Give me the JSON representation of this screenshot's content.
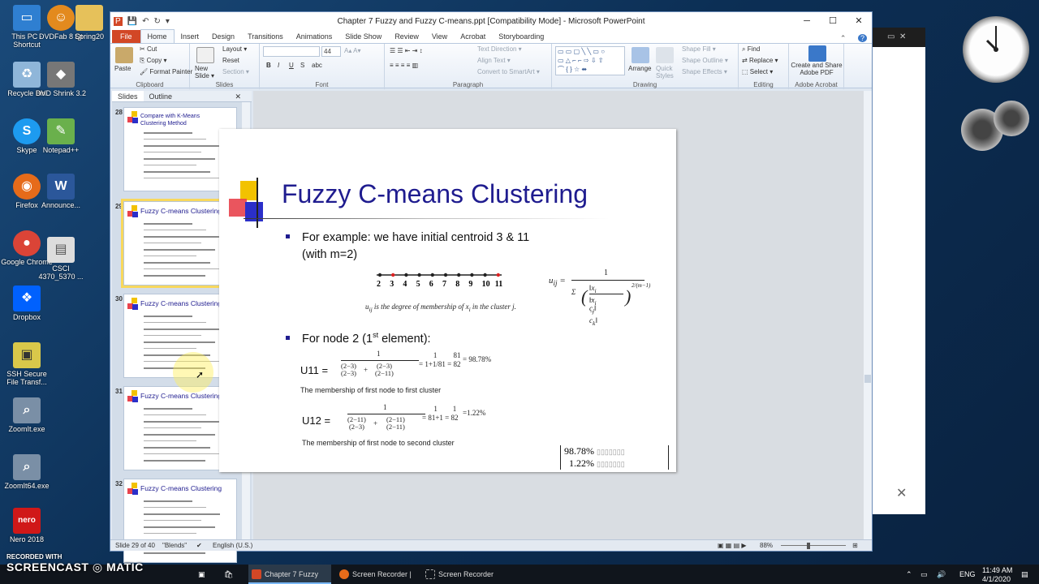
{
  "desktop": {
    "icons": [
      {
        "label": "This PC - Shortcut",
        "icon": "pc-icon",
        "color": "#2f7fd1"
      },
      {
        "label": "DVDFab 8 Qt",
        "icon": "dvdfab-icon",
        "color": "#e38a1e"
      },
      {
        "label": "Spring20",
        "icon": "folder-icon",
        "color": "#e6c15a"
      },
      {
        "label": "Recycle Bin",
        "icon": "recycle-bin-icon",
        "color": "#8fb6d9"
      },
      {
        "label": "DVD Shrink 3.2",
        "icon": "dvd-shrink-icon",
        "color": "#777777"
      },
      {
        "label": "Skype",
        "icon": "skype-icon",
        "color": "#1d9bf0"
      },
      {
        "label": "Notepad++",
        "icon": "notepadpp-icon",
        "color": "#6ab04c"
      },
      {
        "label": "Firefox",
        "icon": "firefox-icon",
        "color": "#e66b1a"
      },
      {
        "label": "Announce...",
        "icon": "word-doc-icon",
        "color": "#2b579a"
      },
      {
        "label": "Google Chrome",
        "icon": "chrome-icon",
        "color": "#db4437"
      },
      {
        "label": "CSCI 4370_5370 ...",
        "icon": "document-icon",
        "color": "#dddddd"
      },
      {
        "label": "Dropbox",
        "icon": "dropbox-icon",
        "color": "#0061fe"
      },
      {
        "label": "SSH Secure File Transf...",
        "icon": "ssh-icon",
        "color": "#d9c84a"
      },
      {
        "label": "ZoomIt.exe",
        "icon": "zoomit-icon",
        "color": "#7a8fa6"
      },
      {
        "label": "ZoomIt64.exe",
        "icon": "zoomit64-icon",
        "color": "#7a8fa6"
      },
      {
        "label": "Nero 2018",
        "icon": "nero-icon",
        "color": "#d01818"
      }
    ]
  },
  "window": {
    "title": "Chapter 7 Fuzzy and Fuzzy C-means.ppt [Compatibility Mode] - Microsoft PowerPoint",
    "min": "─",
    "max": "☐",
    "close": "✕"
  },
  "tabs": [
    "File",
    "Home",
    "Insert",
    "Design",
    "Transitions",
    "Animations",
    "Slide Show",
    "Review",
    "View",
    "Acrobat",
    "Storyboarding"
  ],
  "ribbon": {
    "clipboard": {
      "paste": "Paste",
      "cut": "Cut",
      "copy": "Copy ▾",
      "format_painter": "Format Painter",
      "label": "Clipboard"
    },
    "slides": {
      "new_slide": "New Slide ▾",
      "layout": "Layout ▾",
      "reset": "Reset",
      "section": "Section ▾",
      "label": "Slides"
    },
    "font": {
      "size": "44",
      "label": "Font",
      "bold": "B",
      "italic": "I",
      "underline": "U",
      "strike": "S",
      "abc": "abc"
    },
    "paragraph": {
      "text_direction": "Text Direction ▾",
      "align_text": "Align Text ▾",
      "smartart": "Convert to SmartArt ▾",
      "label": "Paragraph"
    },
    "drawing": {
      "arrange": "Arrange",
      "quick_styles": "Quick Styles",
      "shape_fill": "Shape Fill ▾",
      "shape_outline": "Shape Outline ▾",
      "shape_effects": "Shape Effects ▾",
      "label": "Drawing"
    },
    "editing": {
      "find": "Find",
      "replace": "Replace ▾",
      "select": "Select ▾",
      "label": "Editing"
    },
    "acrobat": {
      "create": "Create and Share Adobe PDF",
      "label": "Adobe Acrobat"
    }
  },
  "panel": {
    "tab_slides": "Slides",
    "tab_outline": "Outline",
    "close": "✕",
    "thumbs": [
      {
        "num": "28",
        "title": "Compare with K-Means Clustering Method"
      },
      {
        "num": "29",
        "title": "Fuzzy C-means Clustering"
      },
      {
        "num": "30",
        "title": "Fuzzy C-means Clustering"
      },
      {
        "num": "31",
        "title": "Fuzzy C-means Clustering"
      },
      {
        "num": "32",
        "title": "Fuzzy C-means Clustering"
      }
    ],
    "thumb28_lines": [
      "Given k, the k-means algorithm is",
      "implemented in four steps:"
    ]
  },
  "slide": {
    "title": "Fuzzy C-means Clustering",
    "bullet1_line1": "For example:  we have initial centroid 3 & 11",
    "bullet1_line2": "(with m=2)",
    "axis_numbers": [
      "2",
      "3",
      "4",
      "5",
      "6",
      "7",
      "8",
      "9",
      "10",
      "11"
    ],
    "membership_note": "u",
    "membership_note_sub": "ij",
    "membership_note_rest": " is the degree of membership of x",
    "membership_note_sub2": "i",
    "membership_note_end": " in the cluster j.",
    "formula_lhs": "u",
    "formula_lhs_sub": "ij",
    "formula_num": "1",
    "bullet2_pre": "For node 2 (1",
    "bullet2_sup": "st",
    "bullet2_post": " element):",
    "u11_label": "U11  =",
    "u11_result": "= 98.78%",
    "u11_note": "The membership of first node to first cluster",
    "u12_label": "U12  =",
    "u12_result": "=1.22%",
    "u12_note": "The membership of first node to second cluster",
    "matrix_row1": "98.78%",
    "matrix_row2": "1.22%"
  },
  "status": {
    "slide": "Slide 29 of 40",
    "theme": "\"Blends\"",
    "lang": "English (U.S.)",
    "zoom": "88%"
  },
  "taskbar": {
    "apps": [
      "Chapter 7 Fuzzy an...",
      "Screen Recorder | S...",
      "Screen Recorder"
    ],
    "time": "11:49 AM",
    "date": "4/1/2020",
    "lang": "ENG",
    "watermark_top": "RECORDED WITH",
    "watermark_brand": "SCREENCAST",
    "watermark_brand2": "MATIC"
  },
  "colors": {
    "title_blue": "#1f1c8f",
    "file_tab": "#d24726",
    "selection": "#f8d85c"
  }
}
